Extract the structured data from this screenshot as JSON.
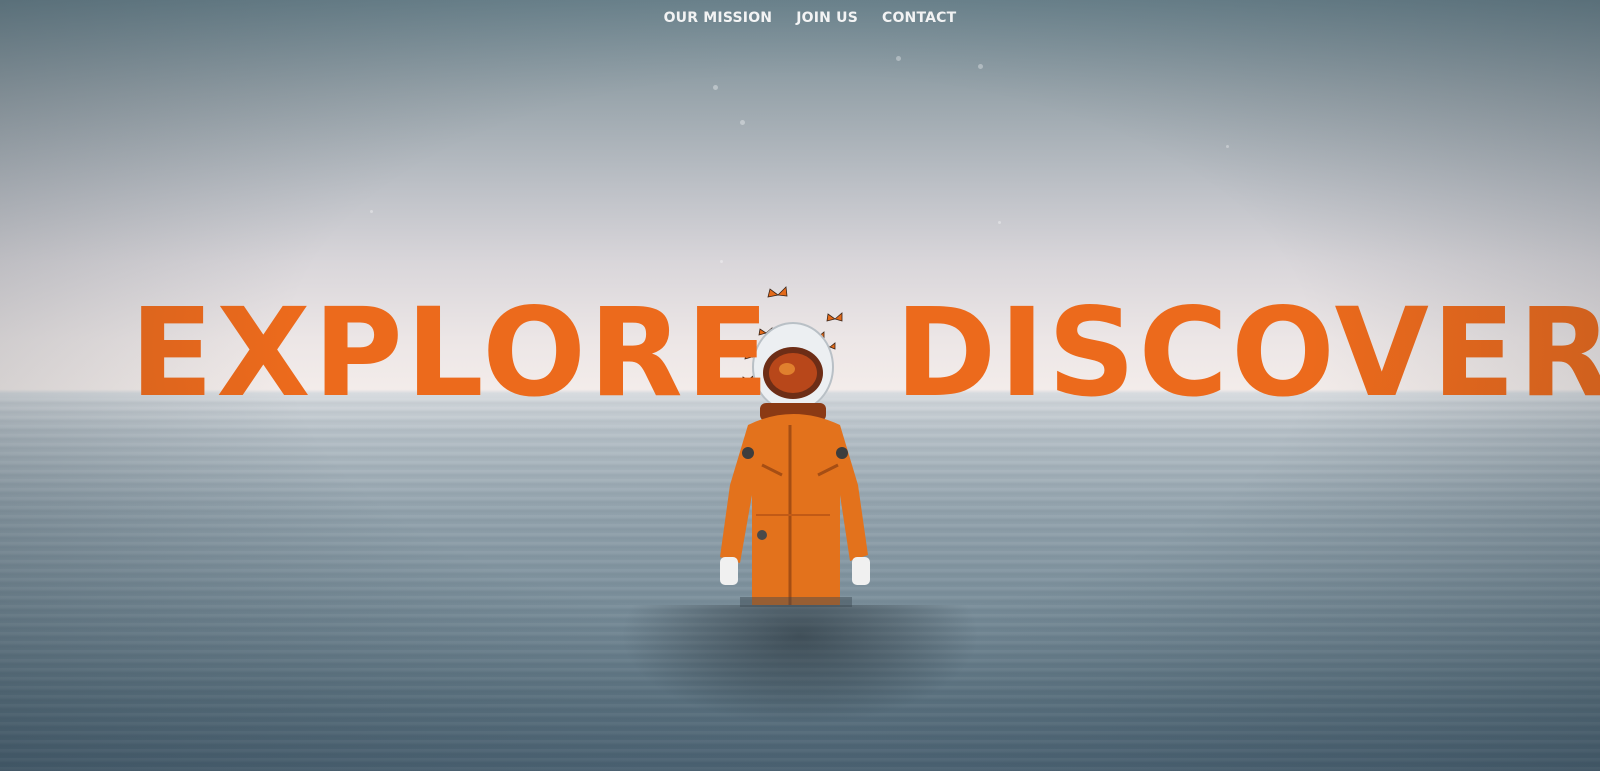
{
  "nav": {
    "items": [
      {
        "label": "OUR MISSION"
      },
      {
        "label": "JOIN US"
      },
      {
        "label": "CONTACT"
      }
    ]
  },
  "hero": {
    "headline_left": "EXPLORE",
    "headline_right": "DISCOVER",
    "accent_color": "#ec6a1c",
    "image": "astronaut-standing-in-ocean-with-butterflies"
  }
}
